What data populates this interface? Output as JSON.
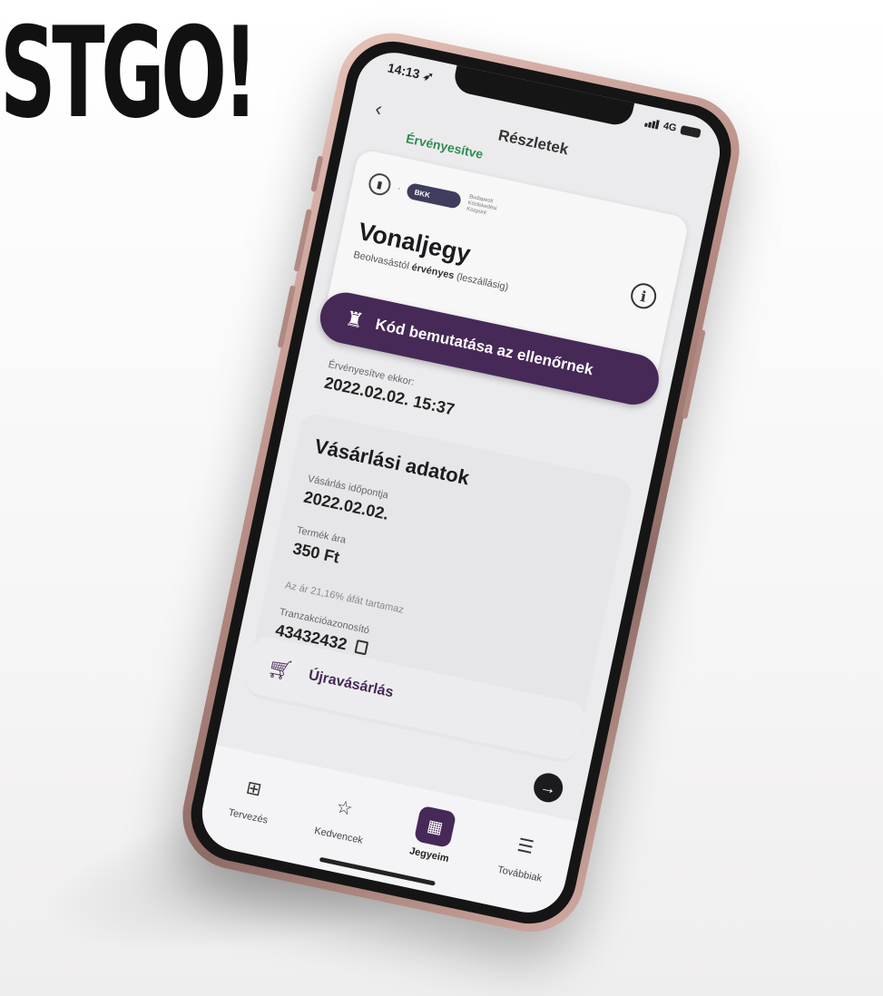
{
  "banner": {
    "headline": "STGO!"
  },
  "status_bar": {
    "time": "14:13 ➶",
    "network": "4G"
  },
  "header": {
    "back_icon": "chevron-left-icon",
    "title": "Részletek"
  },
  "ticket": {
    "status": "Érvényesítve",
    "operator": "BKK",
    "operator_name": "Budapesti Közlekedési Központ",
    "name": "Vonaljegy",
    "validity_prefix": "Beolvasástól",
    "validity_bold": "érvényes",
    "validity_suffix": "(leszállásig)"
  },
  "inspector_button": {
    "label": "Kód bemutatása az ellenőrnek"
  },
  "validation": {
    "label": "Érvényesítve ekkor:",
    "value": "2022.02.02. 15:37"
  },
  "purchase": {
    "title": "Vásárlási adatok",
    "date_label": "Vásárlás időpontja",
    "date_value": "2022.02.02.",
    "price_label": "Termék ára",
    "price_value": "350 Ft",
    "vat_note": "Az ár 21,16% áfát tartamaz",
    "transaction_label": "Tranzakcióazonosító",
    "transaction_value": "43432432"
  },
  "rebuy": {
    "label": "Újravásárlás"
  },
  "tabbar": [
    {
      "label": "Tervezés",
      "icon": "map-icon"
    },
    {
      "label": "Kedvencek",
      "icon": "star-icon"
    },
    {
      "label": "Jegyeim",
      "icon": "ticket-icon",
      "active": true
    },
    {
      "label": "Továbbiak",
      "icon": "menu-list-icon"
    }
  ],
  "colors": {
    "accent": "#472957",
    "success": "#2f8b52",
    "frame": "#c39b91"
  }
}
